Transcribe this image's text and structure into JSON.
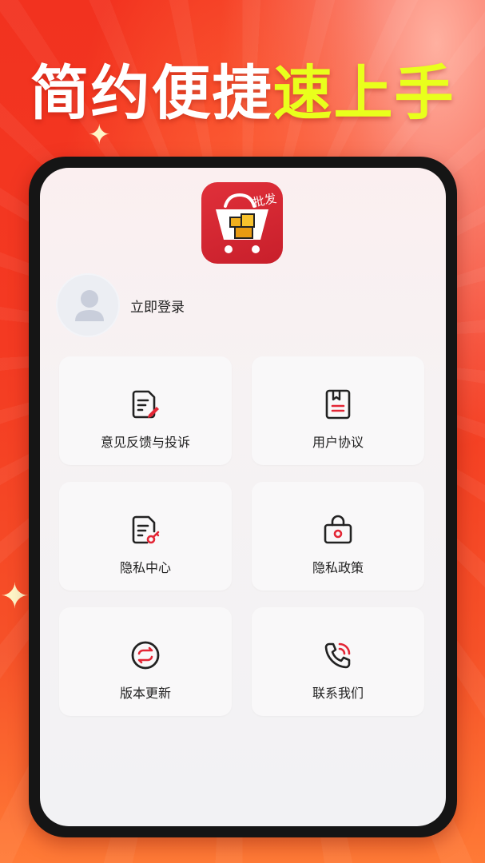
{
  "promo": {
    "headline_white": "简约便捷",
    "headline_yellow": "速上手",
    "colors": {
      "white": "#ffffff",
      "yellow": "#e9ff1c",
      "accent_red": "#e32635"
    }
  },
  "app": {
    "logo_icon": "shopping-cart-box-icon"
  },
  "profile": {
    "login_label": "立即登录",
    "avatar_icon": "user-avatar-icon"
  },
  "menu": [
    {
      "label": "意见反馈与投诉",
      "icon": "feedback-document-edit-icon"
    },
    {
      "label": "用户协议",
      "icon": "user-agreement-book-icon"
    },
    {
      "label": "隐私中心",
      "icon": "privacy-center-document-key-icon"
    },
    {
      "label": "隐私政策",
      "icon": "privacy-policy-bag-icon"
    },
    {
      "label": "版本更新",
      "icon": "version-update-refresh-icon"
    },
    {
      "label": "联系我们",
      "icon": "contact-phone-icon"
    }
  ]
}
